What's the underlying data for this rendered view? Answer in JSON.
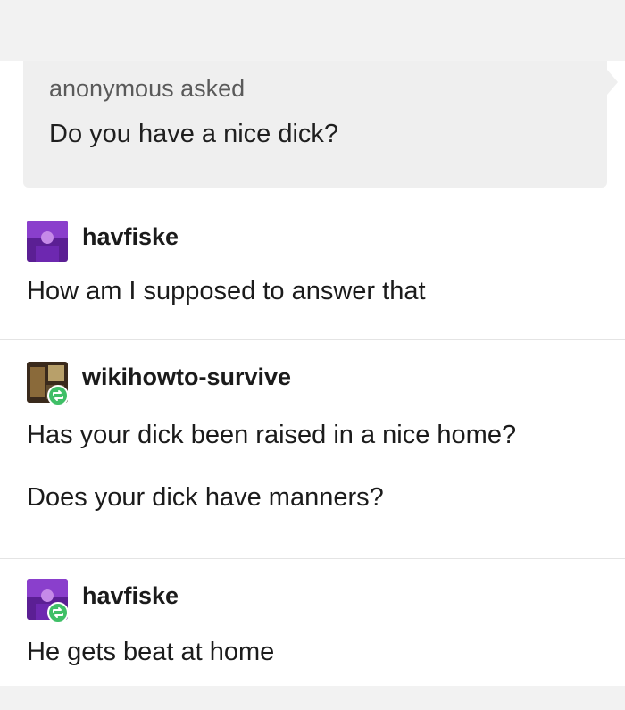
{
  "ask": {
    "asker": "anonymous asked",
    "question": "Do you have a nice dick?"
  },
  "replies": [
    {
      "username": "havfiske",
      "paragraphs": [
        "How am I supposed to answer that"
      ]
    },
    {
      "username": "wikihowto-survive",
      "paragraphs": [
        "Has your dick been raised in a nice home?",
        "Does your dick have manners?"
      ]
    },
    {
      "username": "havfiske",
      "paragraphs": [
        "He gets beat at home"
      ]
    }
  ],
  "colors": {
    "background": "#f2f2f2",
    "post": "#ffffff",
    "ask_box": "#efefef",
    "reblog_badge": "#3fbf67",
    "avatar_havfiske": "#7b2fb5"
  }
}
